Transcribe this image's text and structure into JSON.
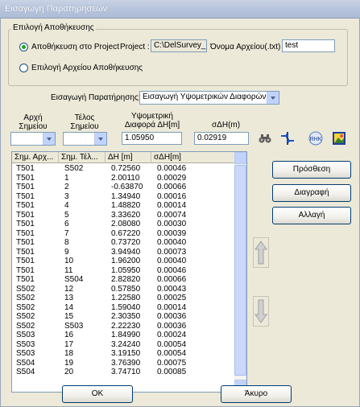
{
  "window": {
    "title": "Εισαγωγή Παρατηρήσεων"
  },
  "storage_group": {
    "title": "Επιλογή Αποθήκευσης",
    "radio_project_label": "Αποθήκευση στο Project",
    "project_label": "Project :",
    "project_value": "C:\\DelSurvey_Pr",
    "filename_label": "Όνομα Αρχείου(.txt)",
    "filename_value": "test",
    "radio_file_label": "Επιλογή Αρχείου Αποθήκευσης"
  },
  "observation": {
    "label": "Εισαγωγή Παρατήρησης:",
    "selected": "Εισαγωγή Υψομετρικών Διαφορών"
  },
  "inputs": {
    "start_point_label": "Αρχή Σημείου",
    "end_point_label": "Τέλος Σημείου",
    "height_diff_label": "Υψομετρική Διαφορά ΔΗ[m]",
    "height_diff_value": "1.05950",
    "sigma_label": "σΔΗ(m)",
    "sigma_value": "0.02919"
  },
  "table": {
    "headers": [
      "Σημ. Αρχ...",
      "Σημ. Τέλ...",
      "ΔΗ [m]",
      "σΔΗ[m]"
    ],
    "rows": [
      [
        "T501",
        "S502",
        "0.72560",
        "0.00046"
      ],
      [
        "T501",
        "1",
        "2.00110",
        "0.00029"
      ],
      [
        "T501",
        "2",
        "-0.63870",
        "0.00066"
      ],
      [
        "T501",
        "3",
        "1.34940",
        "0.00016"
      ],
      [
        "T501",
        "4",
        "1.48820",
        "0.00014"
      ],
      [
        "T501",
        "5",
        "3.33620",
        "0.00074"
      ],
      [
        "T501",
        "6",
        "2.08080",
        "0.00030"
      ],
      [
        "T501",
        "7",
        "0.67220",
        "0.00039"
      ],
      [
        "T501",
        "8",
        "0.73720",
        "0.00040"
      ],
      [
        "T501",
        "9",
        "3.94940",
        "0.00073"
      ],
      [
        "T501",
        "10",
        "1.96200",
        "0.00040"
      ],
      [
        "T501",
        "11",
        "1.05950",
        "0.00046"
      ],
      [
        "T501",
        "S504",
        "2.82820",
        "0.00066"
      ],
      [
        "S502",
        "12",
        "0.57850",
        "0.00043"
      ],
      [
        "S502",
        "13",
        "1.22580",
        "0.00025"
      ],
      [
        "S502",
        "14",
        "1.59040",
        "0.00014"
      ],
      [
        "S502",
        "15",
        "2.30350",
        "0.00036"
      ],
      [
        "S502",
        "S503",
        "2.22230",
        "0.00036"
      ],
      [
        "S503",
        "16",
        "1.84990",
        "0.00024"
      ],
      [
        "S503",
        "17",
        "3.24240",
        "0.00054"
      ],
      [
        "S503",
        "18",
        "3.19150",
        "0.00054"
      ],
      [
        "S504",
        "19",
        "3.76390",
        "0.00075"
      ],
      [
        "S504",
        "20",
        "3.74710",
        "0.00085"
      ]
    ]
  },
  "buttons": {
    "add": "Πρόσθεση",
    "delete": "Διαγραφή",
    "change": "Αλλαγή",
    "ok": "OK",
    "cancel": "Άκυρο"
  },
  "colors": {
    "dialog_bg": "#ece9d8",
    "titlebar": "#b7c4dc",
    "selected_radio": "#21a121"
  }
}
